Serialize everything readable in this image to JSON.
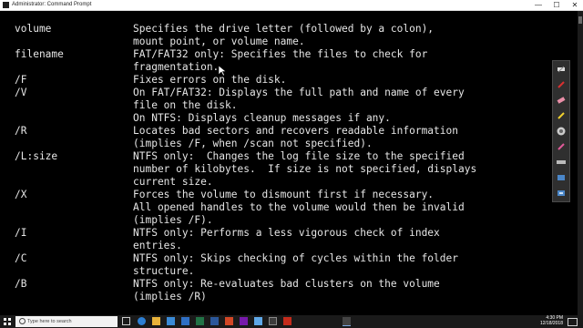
{
  "window": {
    "title": "Administrator: Command Prompt",
    "controls": {
      "minimize": "—",
      "maximize": "☐",
      "close": "✕"
    }
  },
  "console_lines": [
    {
      "cmd": "volume",
      "text": "Specifies the drive letter (followed by a colon),"
    },
    {
      "cmd": "",
      "text": "mount point, or volume name."
    },
    {
      "cmd": "filename",
      "text": "FAT/FAT32 only: Specifies the files to check for"
    },
    {
      "cmd": "",
      "text": "fragmentation."
    },
    {
      "cmd": "/F",
      "text": "Fixes errors on the disk."
    },
    {
      "cmd": "/V",
      "text": "On FAT/FAT32: Displays the full path and name of every"
    },
    {
      "cmd": "",
      "text": "file on the disk."
    },
    {
      "cmd": "",
      "text": "On NTFS: Displays cleanup messages if any."
    },
    {
      "cmd": "/R",
      "text": "Locates bad sectors and recovers readable information"
    },
    {
      "cmd": "",
      "text": "(implies /F, when /scan not specified)."
    },
    {
      "cmd": "/L:size",
      "text": "NTFS only:  Changes the log file size to the specified"
    },
    {
      "cmd": "",
      "text": "number of kilobytes.  If size is not specified, displays"
    },
    {
      "cmd": "",
      "text": "current size."
    },
    {
      "cmd": "/X",
      "text": "Forces the volume to dismount first if necessary."
    },
    {
      "cmd": "",
      "text": "All opened handles to the volume would then be invalid"
    },
    {
      "cmd": "",
      "text": "(implies /F)."
    },
    {
      "cmd": "/I",
      "text": "NTFS only: Performs a less vigorous check of index"
    },
    {
      "cmd": "",
      "text": "entries."
    },
    {
      "cmd": "/C",
      "text": "NTFS only: Skips checking of cycles within the folder"
    },
    {
      "cmd": "",
      "text": "structure."
    },
    {
      "cmd": "/B",
      "text": "NTFS only: Re-evaluates bad clusters on the volume"
    },
    {
      "cmd": "",
      "text": "(implies /R)"
    }
  ],
  "ink_tools": [
    "highlighter-icon",
    "pen-red-icon",
    "eraser-icon",
    "pen-yellow-icon",
    "color-wheel-icon",
    "pen-pink-icon",
    "ruler-icon",
    "screen-icon",
    "screen-icon-2"
  ],
  "taskbar": {
    "search_placeholder": "Type here to search",
    "apps": [
      "task-view-icon",
      "edge-icon",
      "file-explorer-icon",
      "store-icon",
      "mail-icon",
      "excel-icon",
      "word-icon",
      "powerpoint-icon",
      "onenote-icon",
      "snip-icon",
      "camera-icon",
      "media-icon",
      "terminal-icon"
    ],
    "clock_time": "4:30 PM",
    "clock_date": "12/18/2018"
  },
  "colors": {
    "console_bg": "#000000",
    "console_text": "#e6e6e6",
    "taskbar_bg": "#1a1a1a"
  }
}
